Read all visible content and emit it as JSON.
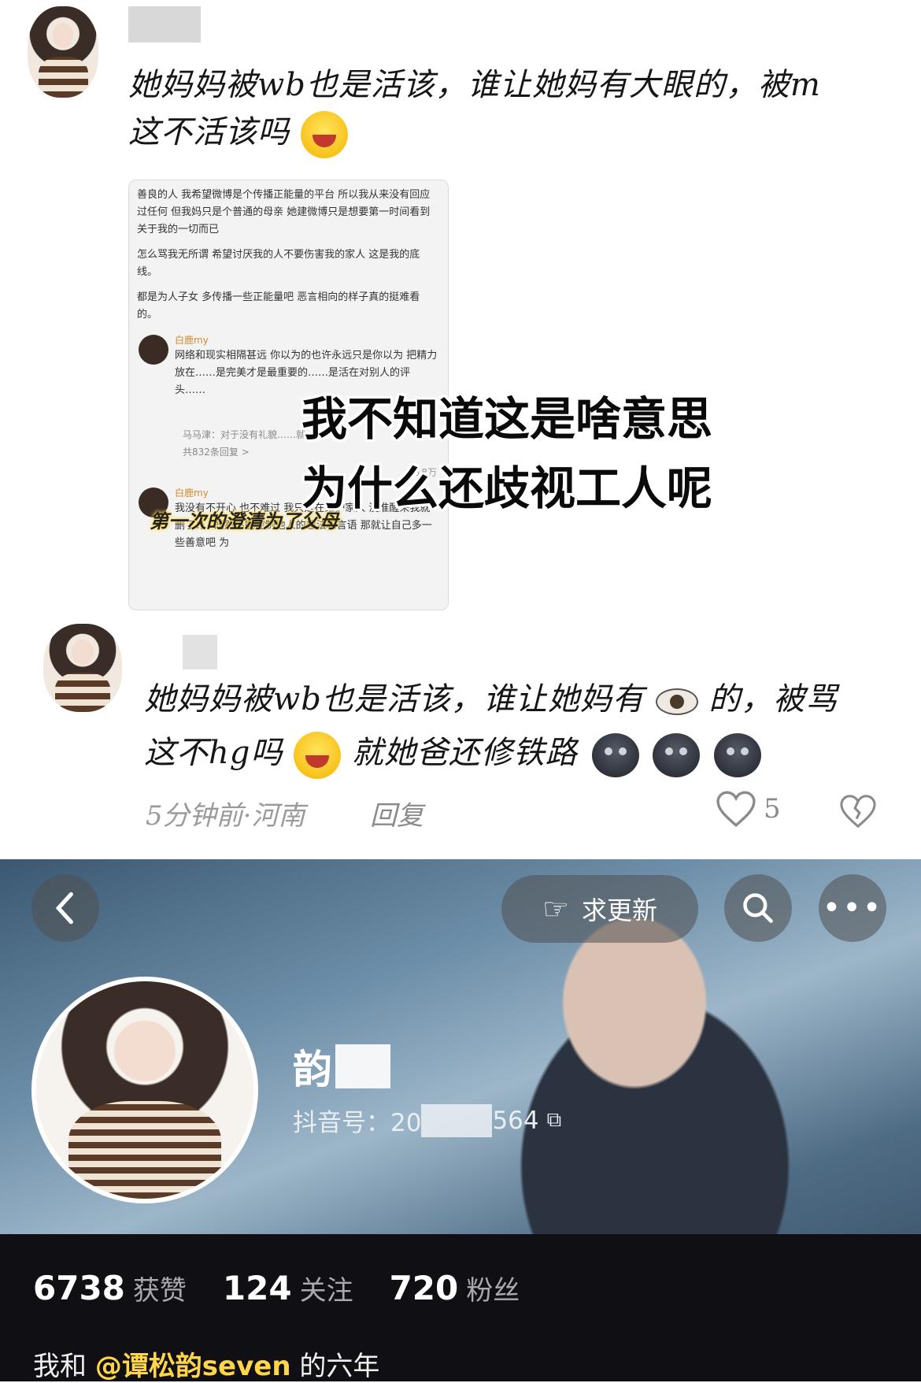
{
  "comment1": {
    "line1": "她妈妈被wb也是活该，谁让她妈有大眼的，被m",
    "line2": "这不活该吗"
  },
  "screenshot": {
    "paragraph1": "善良的人 我希望微博是个传播正能量的平台 所以我从来没有回应过任何 但我妈只是个普通的母亲 她建微博只是想要第一时间看到关于我的一切而已",
    "paragraph2": "怎么骂我无所谓 希望讨厌我的人不要伤害我的家人 这是我的底线。",
    "paragraph3": "都是为人子女 多传播一些正能量吧 恶言相向的样子真的挺难看的。",
    "reply1_name": "白鹿my",
    "reply1_text": "网络和现实相隔甚远 你以为的也许永远只是你以为 把精力放在……是完美才是最重要的……是活在对别人的评头……",
    "sub_reply": "马马津：对于没有礼貌……就……",
    "sub_reply_count": "共832条回复 >",
    "likes": "18万",
    "reply2_name": "白鹿my",
    "reply2_text": "我没有不开心 也不难过 我只是在维护家人 没准醒来我就删了：） 既然不能控制他人的想法和言语 那就让自己多一些善意吧 为",
    "caption": "第一次的澄清为了父母"
  },
  "overlay": {
    "line1": "我不知道这是啥意思",
    "line2": "为什么还歧视工人呢"
  },
  "comment2": {
    "line1_a": "她妈妈被wb也是活该，谁让她妈有",
    "line1_b": "的，被骂",
    "line2_a": "这不hg吗",
    "line2_b": "就她爸还修铁路",
    "time_location": "5分钟前·河南",
    "reply_label": "回复",
    "like_count": "5"
  },
  "profile": {
    "follow_update_label": "求更新",
    "name": "韵",
    "douyin_id": "抖音号：20",
    "douyin_id_tail": "564",
    "stats": [
      {
        "value": "6738",
        "label": "获赞"
      },
      {
        "value": "124",
        "label": "关注"
      },
      {
        "value": "720",
        "label": "粉丝"
      }
    ],
    "bio_prefix": "我和",
    "bio_mention": "@谭松韵seven",
    "bio_suffix": "的六年"
  },
  "colors": {
    "mention": "#ffd54a",
    "stats_bg": "#0f0f14",
    "caption_glow": "#ffd84d"
  }
}
